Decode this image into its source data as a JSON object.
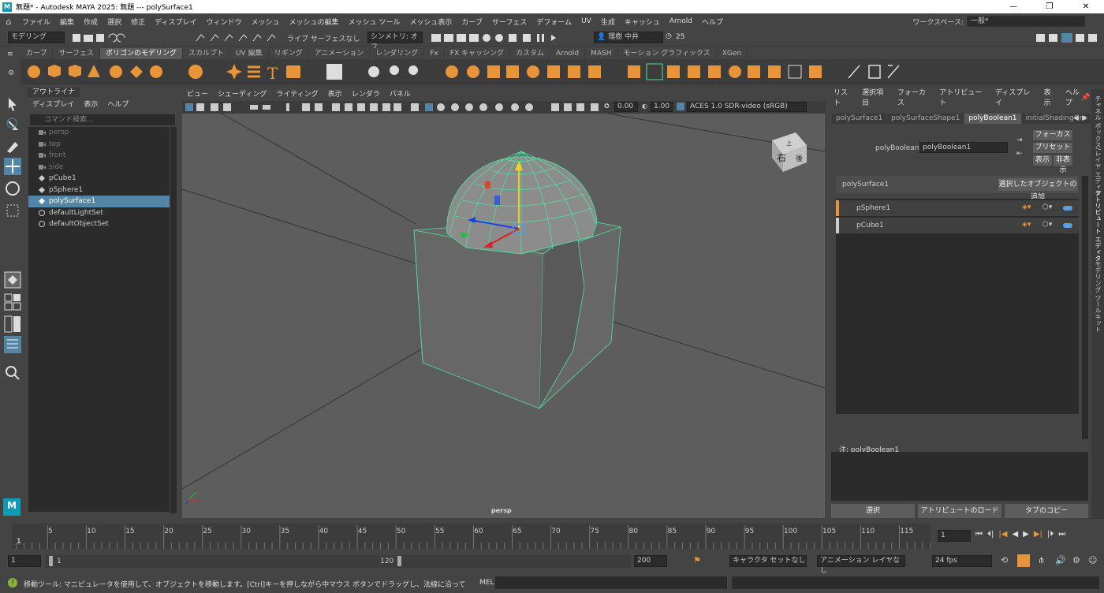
{
  "window": {
    "title": "無題* - Autodesk MAYA 2025: 無題   ---   polySurface1",
    "app_icon": "maya-logo-icon",
    "controls": [
      "—",
      "❐",
      "✕"
    ]
  },
  "menubar": {
    "items": [
      "ファイル",
      "編集",
      "作成",
      "選択",
      "修正",
      "ディスプレイ",
      "ウィンドウ",
      "メッシュ",
      "メッシュの編集",
      "メッシュ ツール",
      "メッシュ表示",
      "カーブ",
      "サーフェス",
      "デフォーム",
      "UV",
      "生成",
      "キャッシュ",
      "Arnold",
      "ヘルプ"
    ],
    "workspace_label": "ワークスペース:",
    "workspace_value": "一般*"
  },
  "statusline": {
    "mode": "モデリング",
    "live_label": "ライブ サーフェスなし",
    "symmetry": "シンメトリ: オフ",
    "user": "理樹 中井",
    "notification_count": "25"
  },
  "shelf": {
    "tabs": [
      "カーブ",
      "サーフェス",
      "ポリゴンのモデリング",
      "スカルプト",
      "UV 編集",
      "リギング",
      "アニメーション",
      "レンダリング",
      "Fx",
      "FX キャッシング",
      "カスタム",
      "Arnold",
      "MASH",
      "モーション グラフィックス",
      "XGen"
    ],
    "active_tab": 2,
    "accent_color": "#e8953a"
  },
  "outliner": {
    "tabs": [
      "アウトライナ"
    ],
    "menu": [
      "ディスプレイ",
      "表示",
      "ヘルプ"
    ],
    "search_placeholder": "コマンド検索...",
    "items": [
      {
        "label": "persp",
        "type": "camera",
        "dim": true
      },
      {
        "label": "top",
        "type": "camera",
        "dim": true
      },
      {
        "label": "front",
        "type": "camera",
        "dim": true
      },
      {
        "label": "side",
        "type": "camera",
        "dim": true
      },
      {
        "label": "pCube1",
        "type": "mesh",
        "dim": false
      },
      {
        "label": "pSphere1",
        "type": "mesh",
        "dim": false
      },
      {
        "label": "polySurface1",
        "type": "mesh",
        "dim": false,
        "selected": true
      },
      {
        "label": "defaultLightSet",
        "type": "set",
        "dim": false
      },
      {
        "label": "defaultObjectSet",
        "type": "set",
        "dim": false
      }
    ]
  },
  "viewport": {
    "menu": [
      "ビュー",
      "シェーディング",
      "ライティング",
      "表示",
      "レンダラ",
      "パネル"
    ],
    "exposure": "0.00",
    "gamma": "1.00",
    "colorspace": "ACES 1.0 SDR-video (sRGB)",
    "camera_label": "persp",
    "viewcube_face": "右",
    "viewcube_side": "後",
    "viewcube_top": "上",
    "wire_color": "#4de0a0"
  },
  "attribute_editor": {
    "menu": [
      "リスト",
      "選択項目",
      "フォーカス",
      "アトリビュート",
      "ディスプレイ",
      "表示",
      "ヘルプ"
    ],
    "tabs": [
      "polySurface1",
      "polySurfaceShape1",
      "polyBoolean1",
      "initialShadingGro"
    ],
    "active_tab": 2,
    "node_label": "polyBoolean:",
    "node_value": "polyBoolean1",
    "focus_button": "フォーカス",
    "preset_button": "プリセット",
    "show_button": "表示",
    "hide_button": "非表示",
    "object_name": "polySurface1",
    "add_selected_button": "選択したオブジェクトの追加",
    "operands": [
      {
        "name": "pSphere1",
        "color": "#e8953a"
      },
      {
        "name": "pCube1",
        "color": "#cccccc"
      }
    ],
    "notes_label": "注: polyBoolean1",
    "bottom_buttons": [
      "選択",
      "アトリビュートのロード",
      "タブのコピー"
    ],
    "side_tabs": [
      "チャネル ボックス/レイヤ エディタ",
      "アトリビュート エディタ",
      "モデリング ツールキット"
    ]
  },
  "timeline": {
    "ticks": [
      "5",
      "10",
      "15",
      "20",
      "25",
      "30",
      "35",
      "40",
      "45",
      "50",
      "55",
      "60",
      "65",
      "70",
      "75",
      "80",
      "85",
      "90",
      "95",
      "100",
      "105",
      "110",
      "115",
      "12"
    ],
    "start_marker": "1",
    "current_frame": "1"
  },
  "range": {
    "start": "1",
    "inner_start": "1",
    "inner_end": "120",
    "end": "200",
    "character_set": "キャラクタ セットなし",
    "anim_layer": "アニメーション レイヤなし",
    "fps": "24 fps"
  },
  "helpline": {
    "message": "移動ツール: マニピュレータを使用して、オブジェクトを移動します。[Ctrl]キーを押しながら中マウス ボタンでドラッグし、法線に沿ってコンポーネントを移動します。[Shift]キーを押しながらマニピ",
    "script_type": "MEL"
  }
}
